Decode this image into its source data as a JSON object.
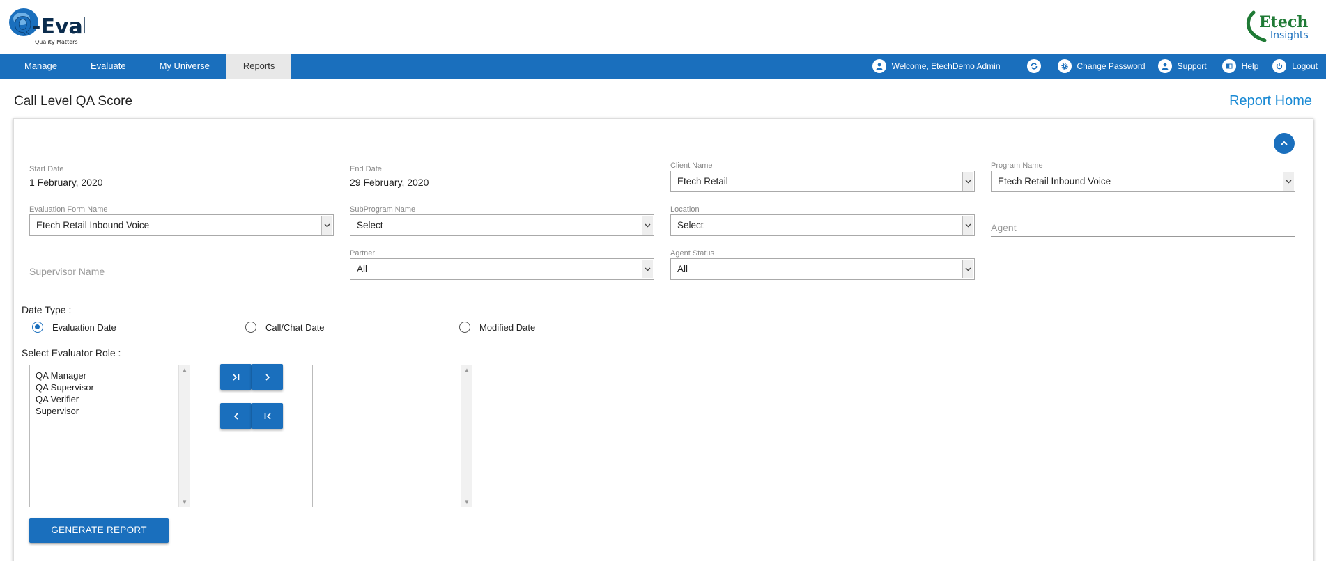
{
  "brand": {
    "logo_text": "Q-Eval",
    "logo_tagline": "Quality Matters",
    "partner_logo_line1": "Etech",
    "partner_logo_line2": "Insights"
  },
  "nav": {
    "items": [
      {
        "label": "Manage"
      },
      {
        "label": "Evaluate"
      },
      {
        "label": "My Universe"
      },
      {
        "label": "Reports",
        "active": true
      }
    ],
    "welcome": "Welcome, EtechDemo Admin",
    "change_password": "Change Password",
    "support": "Support",
    "help": "Help",
    "logout": "Logout"
  },
  "page": {
    "title": "Call Level QA Score",
    "report_home": "Report Home"
  },
  "form": {
    "start_date": {
      "label": "Start Date",
      "value": "1 February, 2020"
    },
    "end_date": {
      "label": "End Date",
      "value": "29 February, 2020"
    },
    "client_name": {
      "label": "Client Name",
      "value": "Etech Retail"
    },
    "program_name": {
      "label": "Program Name",
      "value": "Etech Retail Inbound Voice"
    },
    "evaluation_form_name": {
      "label": "Evaluation Form Name",
      "value": "Etech Retail Inbound Voice"
    },
    "subprogram_name": {
      "label": "SubProgram Name",
      "value": "Select"
    },
    "location": {
      "label": "Location",
      "value": "Select"
    },
    "agent": {
      "placeholder": "Agent"
    },
    "supervisor_name": {
      "placeholder": "Supervisor Name"
    },
    "partner": {
      "label": "Partner",
      "value": "All"
    },
    "agent_status": {
      "label": "Agent Status",
      "value": "All"
    },
    "date_type": {
      "label": "Date Type :",
      "options": [
        {
          "label": "Evaluation Date",
          "selected": true
        },
        {
          "label": "Call/Chat Date",
          "selected": false
        },
        {
          "label": "Modified Date",
          "selected": false
        }
      ]
    },
    "evaluator_role": {
      "label": "Select Evaluator Role :",
      "available": [
        "QA Manager",
        "QA Supervisor",
        "QA Verifier",
        "Supervisor"
      ],
      "selected": []
    },
    "generate_button": "GENERATE REPORT"
  },
  "colors": {
    "primary": "#1a6fbd",
    "link": "#1a8ad4",
    "nav_active_bg": "#e8e8e8"
  }
}
